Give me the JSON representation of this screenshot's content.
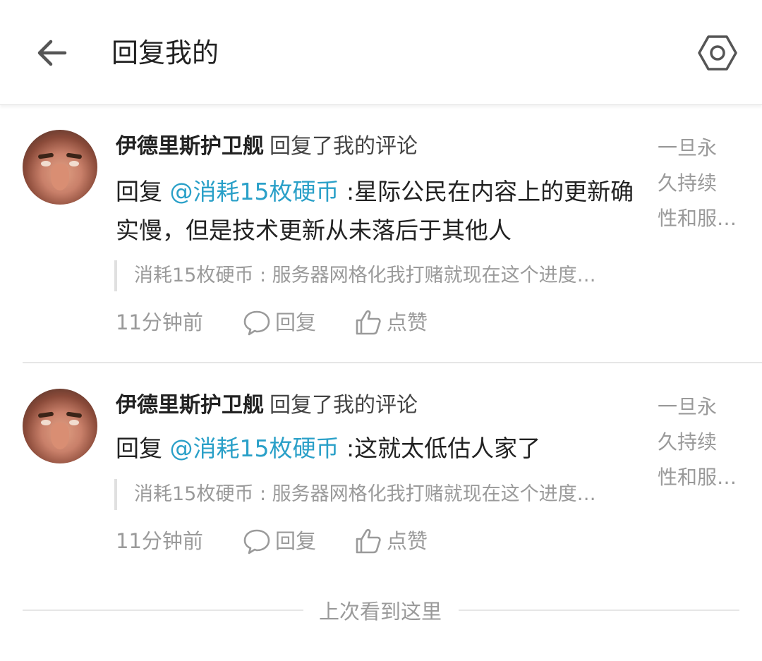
{
  "header": {
    "back_icon": "arrow-left-icon",
    "title": "回复我的",
    "settings_icon": "hexagon-settings-icon"
  },
  "items": [
    {
      "user": "伊德里斯护卫舰",
      "action": "回复了我的评论",
      "reply_prefix": "回复",
      "mention": "@消耗15枚硬币",
      "text": ":星际公民在内容上的更新确实慢，但是技术更新从未落后于其他人",
      "quote": "消耗15枚硬币 : 服务器网格化我打赌就现在这个进度…",
      "time": "11分钟前",
      "reply_label": "回复",
      "like_label": "点赞",
      "source_lines": [
        "一旦永",
        "久持续",
        "性和服…"
      ]
    },
    {
      "user": "伊德里斯护卫舰",
      "action": "回复了我的评论",
      "reply_prefix": "回复",
      "mention": "@消耗15枚硬币",
      "text": ":这就太低估人家了",
      "quote": "消耗15枚硬币 : 服务器网格化我打赌就现在这个进度…",
      "time": "11分钟前",
      "reply_label": "回复",
      "like_label": "点赞",
      "source_lines": [
        "一旦永",
        "久持续",
        "性和服…"
      ]
    }
  ],
  "last_seen": "上次看到这里",
  "colors": {
    "mention": "#2aa0c8",
    "muted": "#9a9a9a",
    "text": "#222222"
  }
}
